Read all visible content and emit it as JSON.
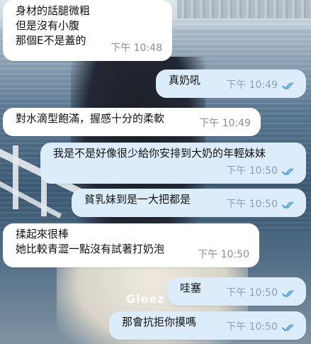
{
  "colors": {
    "incoming_bubble": "#ffffff",
    "outgoing_bubble": "#dcecfb",
    "timestamp": "#8e8e93",
    "read_ticks": "#3d8fd8"
  },
  "background": {
    "watermark_text": "Gleez"
  },
  "messages": [
    {
      "direction": "incoming",
      "text": "身材的話腿微粗\n但是沒有小腹\n那個E不是蓋的",
      "time": "下午 10:48"
    },
    {
      "direction": "outgoing",
      "text": "真奶吼",
      "time": "下午 10:49",
      "status_icon": "double-check-icon"
    },
    {
      "direction": "incoming",
      "text": "對水滴型飽滿，握感十分的柔軟",
      "time": "下午 10:49"
    },
    {
      "direction": "outgoing",
      "text": "我是不是好像很少給你安排到大奶的年輕妹妹",
      "time": "下午 10:50",
      "status_icon": "double-check-icon"
    },
    {
      "direction": "outgoing",
      "text": "貧乳妹到是一大把都是",
      "time": "下午 10:50",
      "status_icon": "double-check-icon"
    },
    {
      "direction": "incoming",
      "text": "揉起來很棒\n她比較青澀一點沒有試著打奶泡",
      "time": "下午 10:50"
    },
    {
      "direction": "outgoing",
      "text": "哇塞",
      "time": "下午 10:50",
      "status_icon": "double-check-icon"
    },
    {
      "direction": "outgoing",
      "text": "那會抗拒你摸嗎",
      "time": "下午 10:50",
      "status_icon": "double-check-icon"
    }
  ]
}
